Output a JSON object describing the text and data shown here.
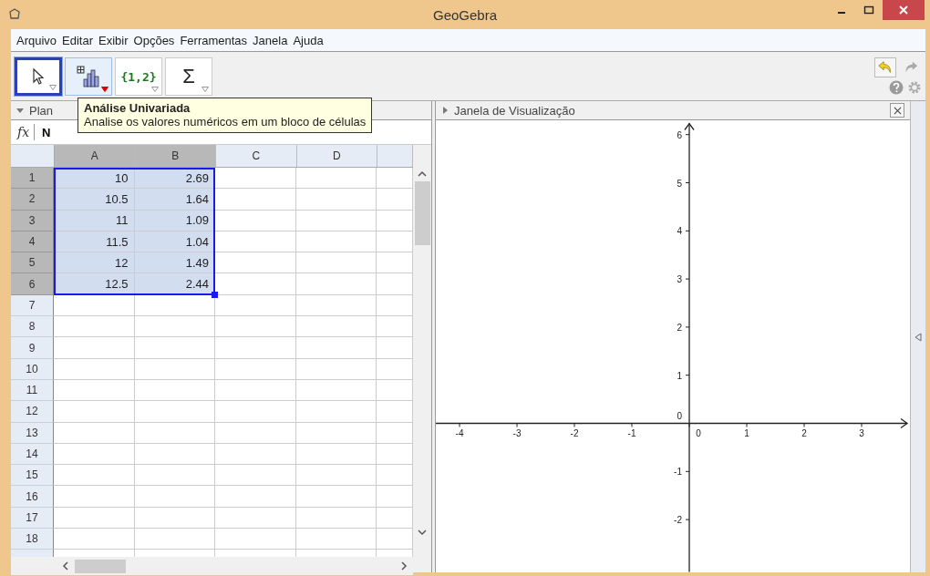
{
  "window": {
    "title": "GeoGebra"
  },
  "menu": [
    "Arquivo",
    "Editar",
    "Exibir",
    "Opções",
    "Ferramentas",
    "Janela",
    "Ajuda"
  ],
  "toolbar": [
    {
      "kind": "pointer",
      "selected": true,
      "hovered": false
    },
    {
      "kind": "histogram",
      "selected": false,
      "hovered": true
    },
    {
      "kind": "label",
      "label": "{1,2}",
      "selected": false,
      "hovered": false
    },
    {
      "kind": "label",
      "label": "Σ",
      "selected": false,
      "hovered": false
    }
  ],
  "tooltip": {
    "title": "Análise Univariada",
    "text": "Analise os valores numéricos em um bloco de células"
  },
  "spreadsheet": {
    "title": "Plan",
    "formula_bar": {
      "icon": "fx",
      "text": "N"
    },
    "columns": [
      {
        "label": "A",
        "selected": true
      },
      {
        "label": "B",
        "selected": true
      },
      {
        "label": "C",
        "selected": false
      },
      {
        "label": "D",
        "selected": false
      }
    ],
    "rows": [
      {
        "label": "1",
        "selected": true,
        "cells": [
          "10",
          "2.69"
        ]
      },
      {
        "label": "2",
        "selected": true,
        "cells": [
          "10.5",
          "1.64"
        ]
      },
      {
        "label": "3",
        "selected": true,
        "cells": [
          "11",
          "1.09"
        ]
      },
      {
        "label": "4",
        "selected": true,
        "cells": [
          "11.5",
          "1.04"
        ]
      },
      {
        "label": "5",
        "selected": true,
        "cells": [
          "12",
          "1.49"
        ]
      },
      {
        "label": "6",
        "selected": true,
        "cells": [
          "12.5",
          "2.44"
        ]
      },
      {
        "label": "7",
        "selected": false
      },
      {
        "label": "8",
        "selected": false
      },
      {
        "label": "9",
        "selected": false
      },
      {
        "label": "10",
        "selected": false
      },
      {
        "label": "11",
        "selected": false
      },
      {
        "label": "12",
        "selected": false
      },
      {
        "label": "13",
        "selected": false
      },
      {
        "label": "14",
        "selected": false
      },
      {
        "label": "15",
        "selected": false
      },
      {
        "label": "16",
        "selected": false
      },
      {
        "label": "17",
        "selected": false
      },
      {
        "label": "18",
        "selected": false
      }
    ]
  },
  "graphics": {
    "title": "Janela de Visualização",
    "x_ticks": [
      "-4",
      "-3",
      "-2",
      "-1",
      "0",
      "1",
      "2",
      "3"
    ],
    "y_ticks": [
      "6",
      "5",
      "4",
      "3",
      "2",
      "1",
      "0",
      "-1",
      "-2"
    ]
  }
}
